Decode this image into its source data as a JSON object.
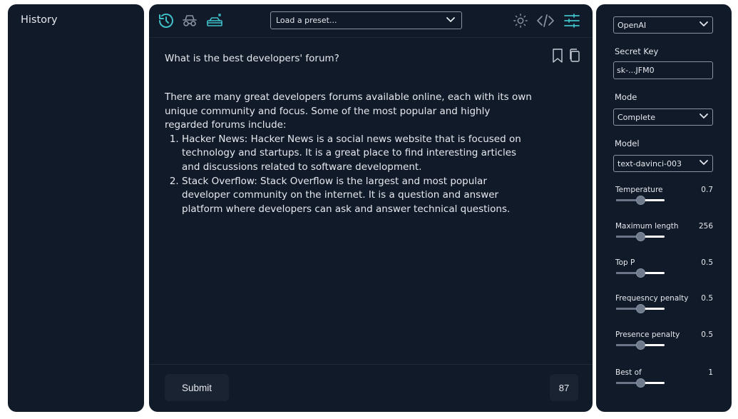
{
  "history": {
    "title": "History"
  },
  "toolbar": {
    "preset_placeholder": "Load a preset...",
    "accent_color": "#3fc0c9"
  },
  "prompt": {
    "text": "What is the best developers' forum?"
  },
  "response": {
    "intro": "There are many great developers forums available online, each with its own unique community and focus. Some of the most popular and highly regarded forums include:",
    "items": [
      "Hacker News: Hacker News is a social news website that is focused on technology and startups. It is a great place to find interesting articles and discussions related to software development.",
      "Stack Overflow: Stack Overflow is the largest and most popular developer community on the internet. It is a question and answer platform where developers can ask and answer technical questions."
    ]
  },
  "footer": {
    "submit_label": "Submit",
    "token_count": "87"
  },
  "settings": {
    "provider": "OpenAI",
    "secret_key_label": "Secret Key",
    "secret_key_value": "sk-...JFM0",
    "mode_label": "Mode",
    "mode_value": "Complete",
    "model_label": "Model",
    "model_value": "text-davinci-003",
    "sliders": [
      {
        "label": "Temperature",
        "value": "0.7",
        "fraction": 0.5
      },
      {
        "label": "Maximum length",
        "value": "256",
        "fraction": 0.5
      },
      {
        "label": "Top P",
        "value": "0.5",
        "fraction": 0.5
      },
      {
        "label": "Frequesncy penalty",
        "value": "0.5",
        "fraction": 0.5
      },
      {
        "label": "Presence penalty",
        "value": "0.5",
        "fraction": 0.5
      },
      {
        "label": "Best of",
        "value": "1",
        "fraction": 0.5
      }
    ]
  }
}
